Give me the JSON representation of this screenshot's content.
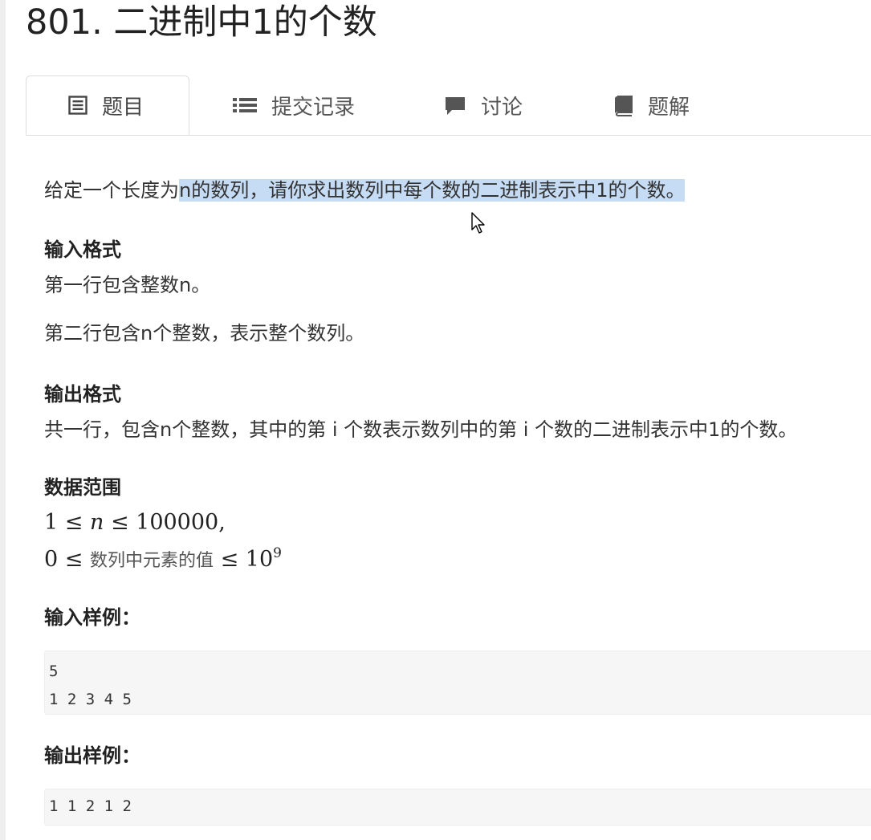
{
  "page": {
    "title": "801. 二进制中1的个数"
  },
  "tabs": [
    {
      "label": "题目",
      "icon": "document-list-icon",
      "active": true
    },
    {
      "label": "提交记录",
      "icon": "list-icon",
      "active": false
    },
    {
      "label": "讨论",
      "icon": "comment-icon",
      "active": false
    },
    {
      "label": "题解",
      "icon": "book-icon",
      "active": false
    }
  ],
  "problem": {
    "description_prefix": "给定一个长度为",
    "description_selected": "n的数列，请你求出数列中每个数的二进制表示中1的个数。",
    "input_heading": "输入格式",
    "input_line1": "第一行包含整数n。",
    "input_line2": "第二行包含n个整数，表示整个数列。",
    "output_heading": "输出格式",
    "output_line1": "共一行，包含n个整数，其中的第 i 个数表示数列中的第 i 个数的二进制表示中1的个数。",
    "range_heading": "数据范围",
    "range_line1_lhs": "1 ≤ ",
    "range_line1_var": "n",
    "range_line1_rhs": " ≤ 100000,",
    "range_line2_lhs": "0 ≤ ",
    "range_line2_cjk": "数列中元素的值",
    "range_line2_rhs": " ≤ 10",
    "range_line2_exp": "9",
    "sample_input_heading": "输入样例：",
    "sample_input": "5\n1 2 3 4 5",
    "sample_output_heading": "输出样例：",
    "sample_output": "1 1 2 1 2"
  },
  "colors": {
    "selection": "#c6dcf5",
    "code_bg": "#f6f6f6",
    "border": "#dddddd"
  }
}
